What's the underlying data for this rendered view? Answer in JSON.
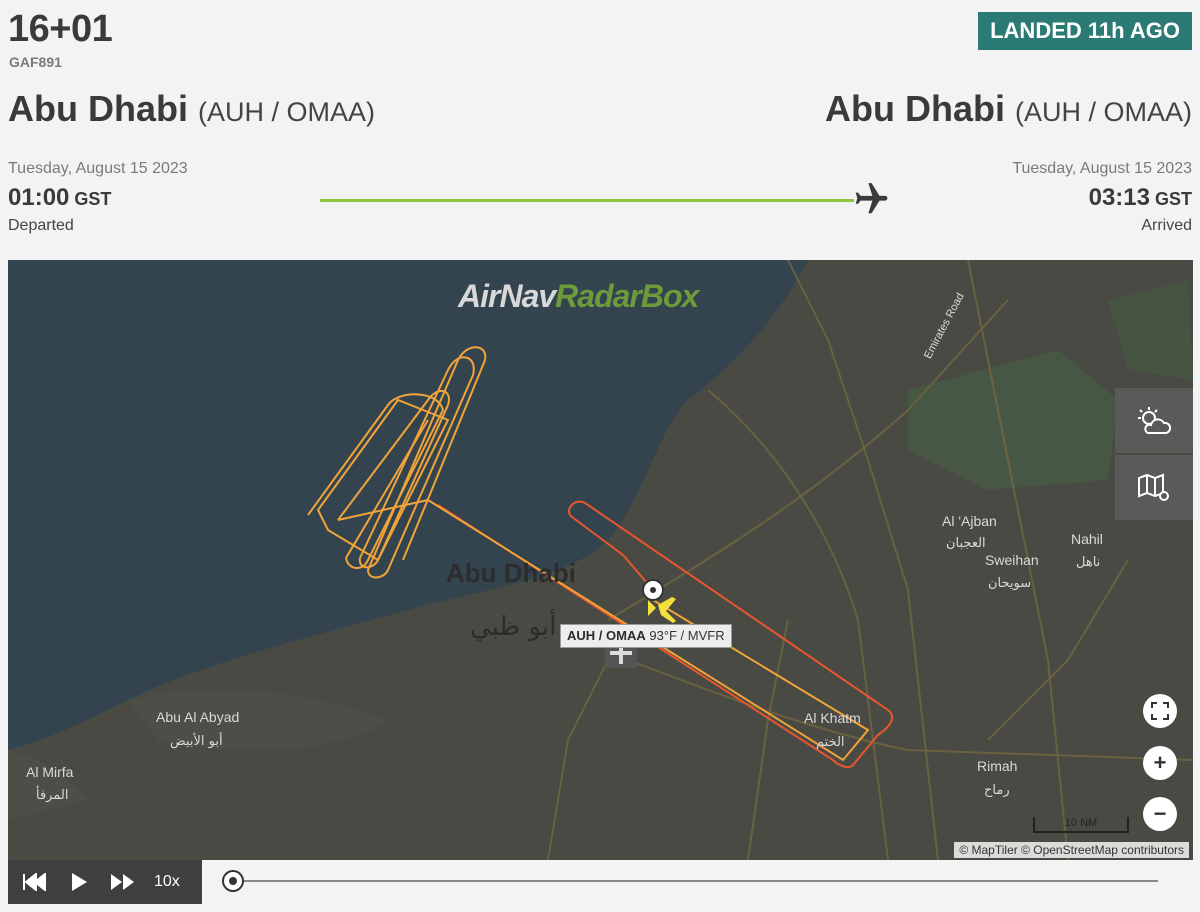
{
  "flight": {
    "number": "16+01",
    "callsign": "GAF891",
    "status": "LANDED 11h AGO",
    "status_color": "#2c7a74"
  },
  "departure": {
    "city": "Abu Dhabi",
    "code": "(AUH / OMAA)",
    "date": "Tuesday, August 15 2023",
    "time": "01:00",
    "tz": "GST",
    "status": "Departed"
  },
  "arrival": {
    "city": "Abu Dhabi",
    "code": "(AUH / OMAA)",
    "date": "Tuesday, August 15 2023",
    "time": "03:13",
    "tz": "GST",
    "status": "Arrived"
  },
  "progress": {
    "fraction": 1.0,
    "color": "#8dc63f",
    "icon": "airplane-icon"
  },
  "map": {
    "logo_airnav": "AirNav",
    "logo_radarbox": "RadarBox",
    "labels": {
      "road": "Emirates Road",
      "abu_dhabi": "Abu Dhabi",
      "abu_dhabi_ar": "أبو ظبي",
      "al_ajban": "Al 'Ajban",
      "al_ajban_ar": "العجبان",
      "nahil": "Nahil",
      "nahil_ar": "ناهل",
      "sweihan": "Sweihan",
      "sweihan_ar": "سويحان",
      "abu_al_abyad": "Abu Al Abyad",
      "abu_al_abyad_ar": "أبو الأبيض",
      "al_mirfa": "Al Mirfa",
      "al_mirfa_ar": "المرفأ",
      "al_khatm": "Al Khatm",
      "al_khatm_ar": "الختم",
      "rimah": "Rimah",
      "rimah_ar": "رماح"
    },
    "airport_tag": {
      "code": "AUH / OMAA",
      "weather": "93°F / MVFR"
    },
    "scale": "10 NM",
    "attribution": "© MapTiler © OpenStreetMap contributors",
    "track_colors": [
      "#f0a43a",
      "#e8562e"
    ],
    "buttons": [
      "weather-icon",
      "map-layers-icon",
      "fullscreen-icon",
      "zoom-in-icon",
      "zoom-out-icon"
    ]
  },
  "player": {
    "speed": "10x",
    "position": 0.0
  }
}
